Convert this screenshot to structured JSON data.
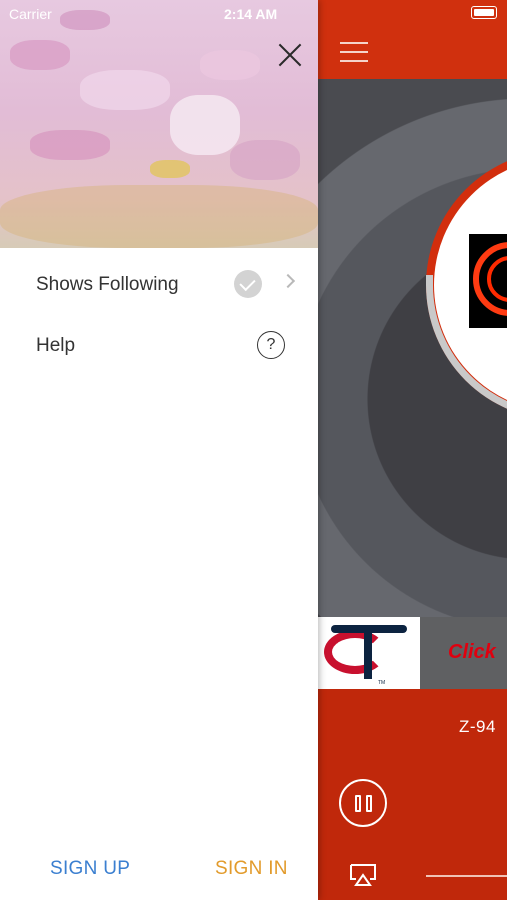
{
  "status_bar": {
    "carrier": "Carrier",
    "time": "2:14 AM"
  },
  "drawer": {
    "menu_items": [
      {
        "label": "Shows Following",
        "icon": "checkmark-circle-icon",
        "has_chevron": true
      },
      {
        "label": "Help",
        "icon": "question-circle-icon"
      }
    ],
    "sign_up_label": "SIGN UP",
    "sign_in_label": "SIGN IN"
  },
  "player": {
    "station_name": "Z-94",
    "ad_text": "Click"
  },
  "colors": {
    "accent_red": "#c0280b",
    "sign_up": "#3b7fd0",
    "sign_in": "#e29b2c"
  }
}
